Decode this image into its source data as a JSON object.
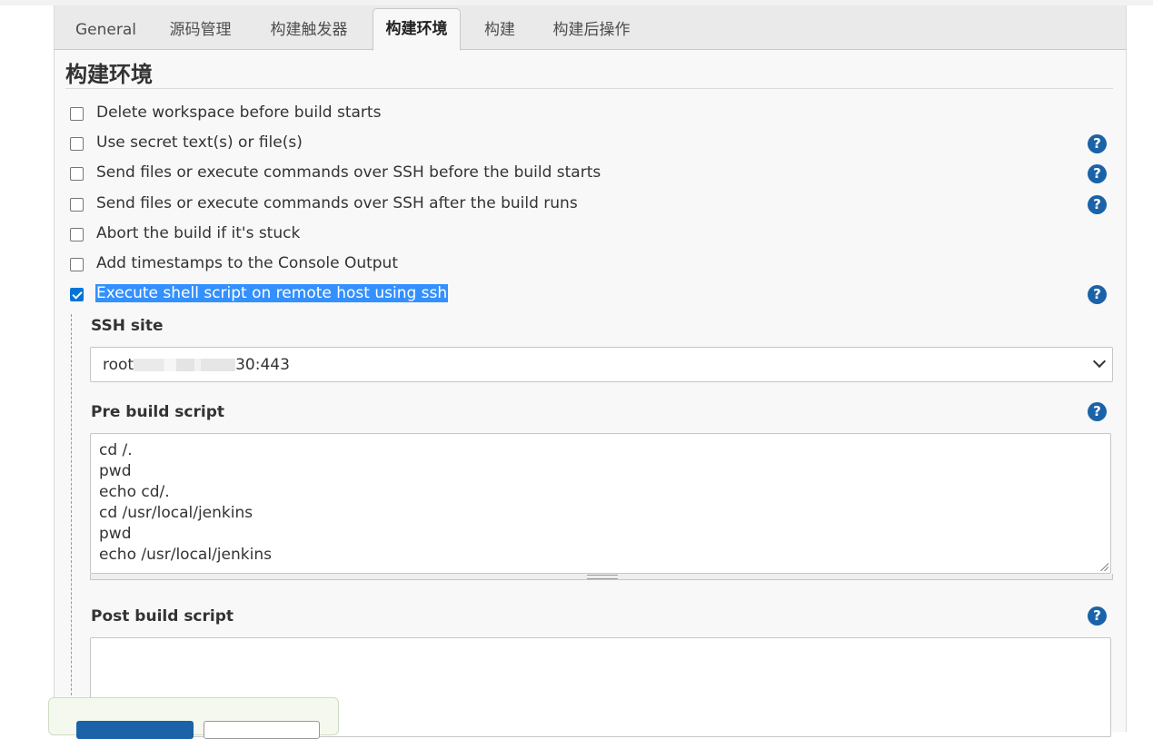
{
  "tabs": [
    {
      "label": "General"
    },
    {
      "label": "源码管理"
    },
    {
      "label": "构建触发器"
    },
    {
      "label": "构建环境",
      "active": true
    },
    {
      "label": "构建"
    },
    {
      "label": "构建后操作"
    }
  ],
  "section": {
    "title": "构建环境"
  },
  "options": [
    {
      "label": "Delete workspace before build starts",
      "checked": false,
      "help": false
    },
    {
      "label": "Use secret text(s) or file(s)",
      "checked": false,
      "help": true
    },
    {
      "label": "Send files or execute commands over SSH before the build starts",
      "checked": false,
      "help": true
    },
    {
      "label": "Send files or execute commands over SSH after the build runs",
      "checked": false,
      "help": true
    },
    {
      "label": "Abort the build if it's stuck",
      "checked": false,
      "help": false
    },
    {
      "label": "Add timestamps to the Console Output",
      "checked": false,
      "help": false
    },
    {
      "label": "Execute shell script on remote host using ssh",
      "checked": true,
      "help": true
    }
  ],
  "help_glyph": "?",
  "ssh_site": {
    "label": "SSH site",
    "value_prefix": "root",
    "value_suffix": "30:443"
  },
  "pre_build": {
    "label": "Pre build script",
    "lines": [
      "cd /.",
      "pwd",
      "echo cd/.",
      "cd /usr/local/jenkins",
      "pwd",
      "echo /usr/local/jenkins"
    ]
  },
  "post_build": {
    "label": "Post build script",
    "lines": []
  },
  "colors": {
    "accent": "#1a63a8",
    "selection": "#3390ff",
    "checkbox": "#0075d9"
  }
}
